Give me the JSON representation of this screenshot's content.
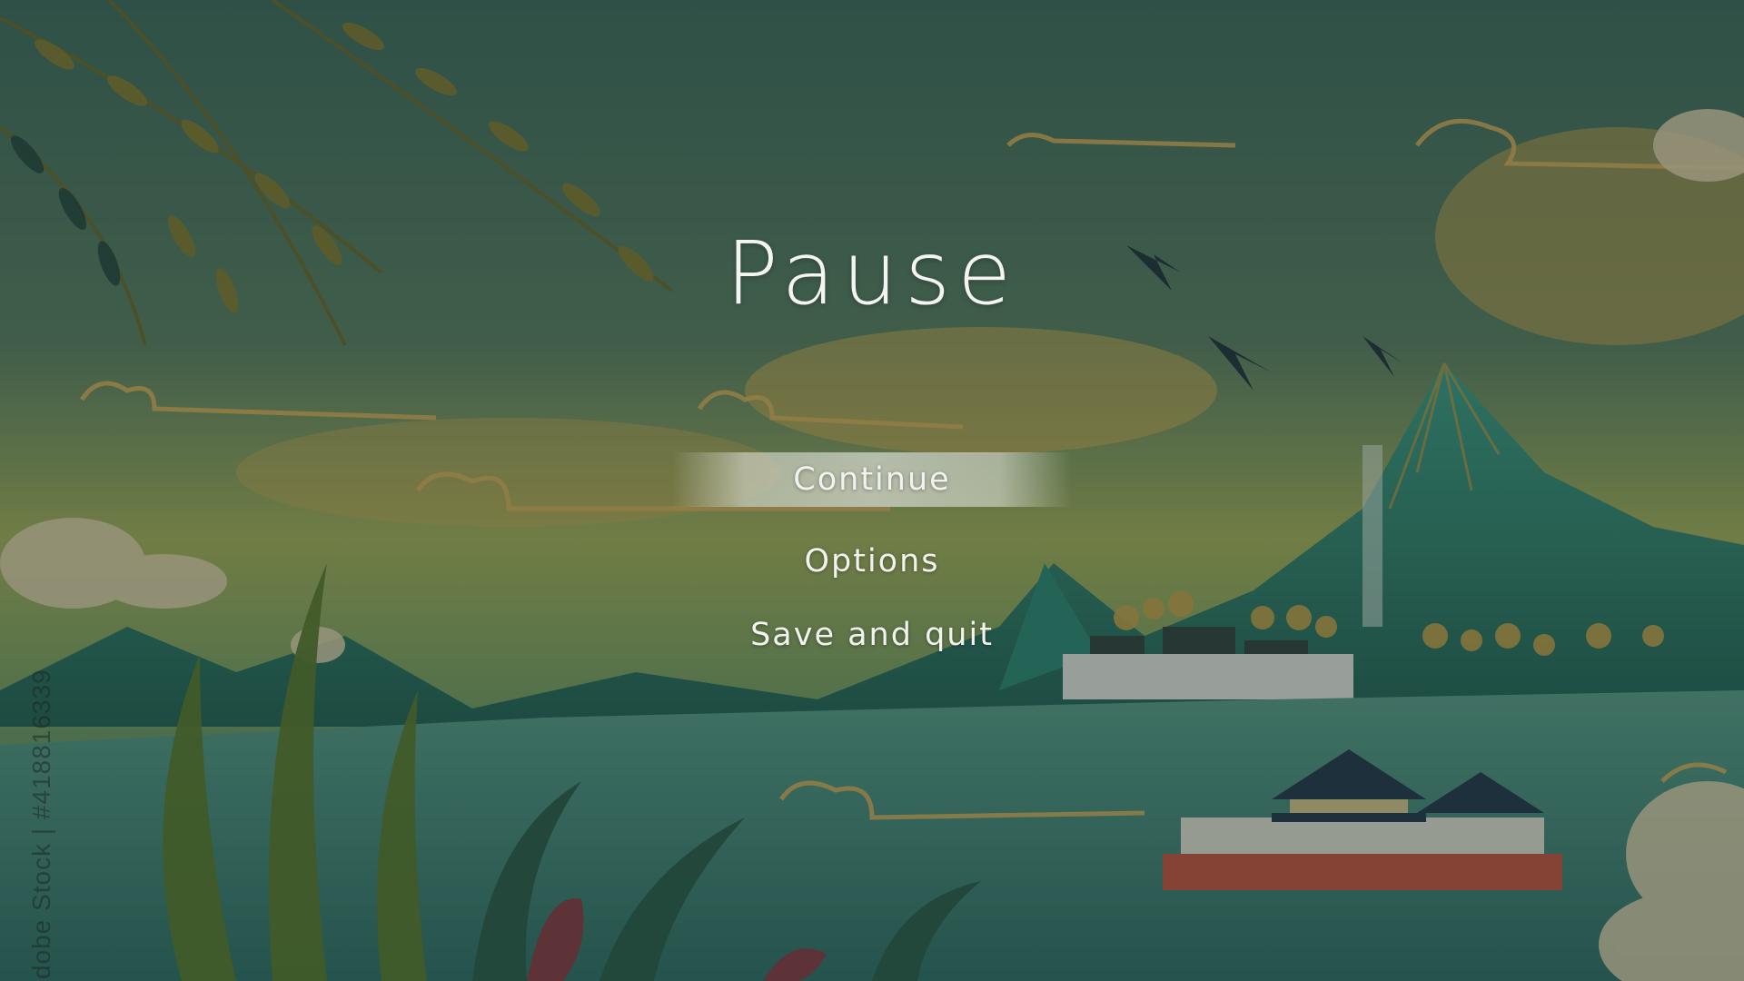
{
  "pause_menu": {
    "title": "Pause",
    "items": [
      {
        "label": "Continue",
        "selected": true
      },
      {
        "label": "Options",
        "selected": false
      },
      {
        "label": "Save and quit",
        "selected": false
      }
    ]
  },
  "watermark": {
    "text": "dobe Stock | #418816339"
  },
  "colors": {
    "sky": "#4f7560",
    "mountain": "#2f7a66",
    "cloud_gold": "#d8a24a",
    "water": "#3f8a80",
    "highlight": "#d2d6cc"
  }
}
